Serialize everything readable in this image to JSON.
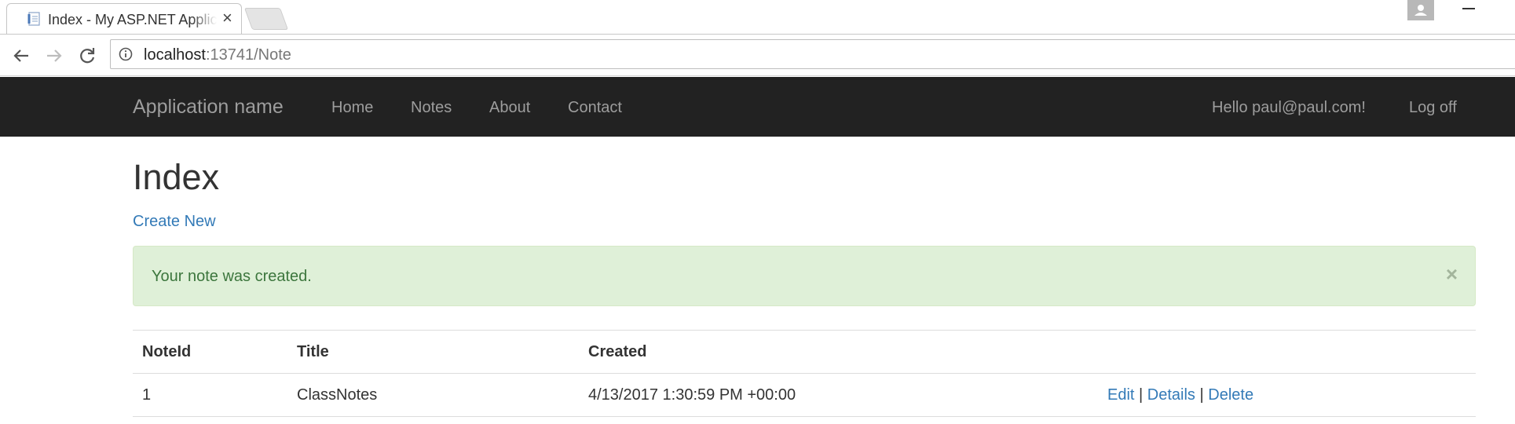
{
  "browser": {
    "tab_title": "Index - My ASP.NET Application",
    "tab_close": "×",
    "url_host": "localhost",
    "url_rest": ":13741/Note"
  },
  "navbar": {
    "brand": "Application name",
    "links": [
      "Home",
      "Notes",
      "About",
      "Contact"
    ],
    "greeting": "Hello paul@paul.com!",
    "logoff": "Log off"
  },
  "page": {
    "title": "Index",
    "create_new": "Create New"
  },
  "alert": {
    "message": "Your note was created.",
    "close": "×"
  },
  "table": {
    "headers": [
      "NoteId",
      "Title",
      "Created",
      ""
    ],
    "rows": [
      {
        "note_id": "1",
        "title": "ClassNotes",
        "created": "4/13/2017 1:30:59 PM +00:00",
        "actions": [
          "Edit",
          "Details",
          "Delete"
        ],
        "separator": "|"
      }
    ]
  },
  "colors": {
    "navbar_bg": "#222222",
    "navbar_text": "#9d9d9d",
    "link": "#337ab7",
    "alert_bg": "#dff0d8",
    "alert_text": "#3c763d"
  },
  "icons": [
    "page-favicon-icon",
    "close-icon",
    "new-tab-icon",
    "profile-icon",
    "minimize-icon",
    "back-arrow-icon",
    "forward-arrow-icon",
    "reload-icon",
    "info-icon"
  ]
}
